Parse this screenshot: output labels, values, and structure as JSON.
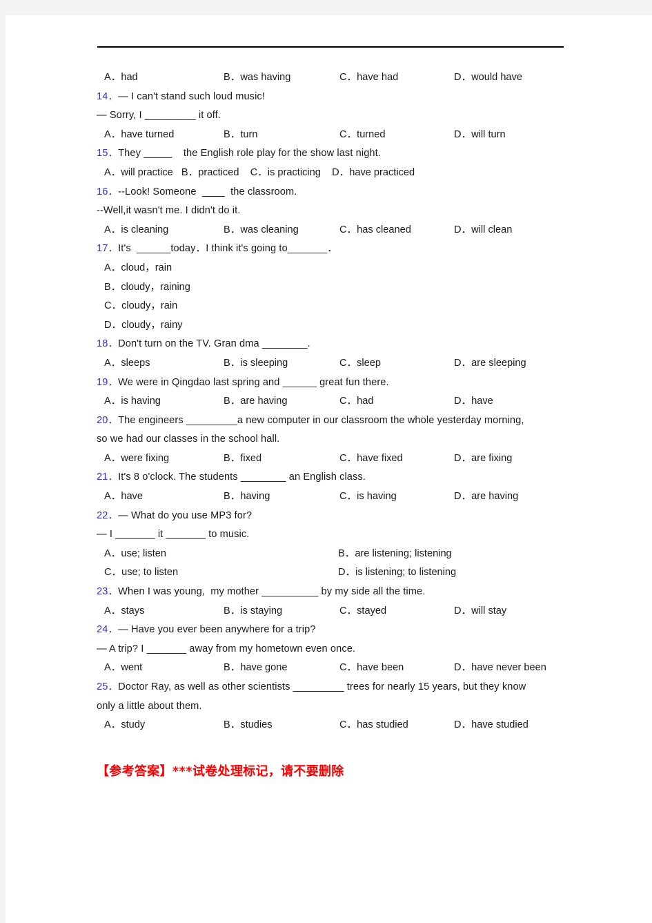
{
  "document": {
    "type": "english-grammar-worksheet",
    "colors": {
      "page_background": "#ffffff",
      "outer_background": "#f3f3f3",
      "question_number": "#3333cc",
      "body_text": "#1a1a1a",
      "answer_key": "#ff0000",
      "rule": "#000000"
    },
    "q13_options": {
      "a": "A．had",
      "b": "B．was having",
      "c": "C．have had",
      "d": "D．would have"
    },
    "q14": {
      "number": "14．",
      "stem_line1": "— I can't stand such loud music!",
      "stem_line2": "— Sorry, I _________ it off.",
      "options": {
        "a": "A．have turned",
        "b": "B．turn",
        "c": "C．turned",
        "d": "D．will turn"
      }
    },
    "q15": {
      "number": "15．",
      "stem": "They _____    the English role play for the show last night.",
      "options_inline": "A．will practice   B．practiced    C．is practicing    D．have practiced"
    },
    "q16": {
      "number": "16．",
      "stem_line1": "--Look! Someone  ____  the classroom.",
      "stem_line2": "--Well,it wasn't me. I didn't do it.",
      "options": {
        "a": "A．is cleaning",
        "b": "B．was cleaning",
        "c": "C．has cleaned",
        "d": "D．will clean"
      }
    },
    "q17": {
      "number": "17．",
      "stem": "It's  ______today．I think it's going to_______．",
      "options_stacked": [
        "A．cloud，rain",
        "B．cloudy，raining",
        "C．cloudy，rain",
        "D．cloudy，rainy"
      ]
    },
    "q18": {
      "number": "18．",
      "stem": "Don't turn on the TV. Gran dma ________.",
      "options": {
        "a": "A．sleeps",
        "b": "B．is sleeping",
        "c": "C．sleep",
        "d": "D．are sleeping"
      }
    },
    "q19": {
      "number": "19．",
      "stem": "We were in Qingdao last spring and ______ great fun there.",
      "options": {
        "a": "A．is having",
        "b": "B．are having",
        "c": "C．had",
        "d": "D．have"
      }
    },
    "q20": {
      "number": "20．",
      "stem_line1": "The engineers _________a new computer in our classroom the whole yesterday morning,",
      "stem_line2": "so we had our classes in the school hall.",
      "options": {
        "a": "A．were fixing",
        "b": "B．fixed",
        "c": "C．have fixed",
        "d": "D．are fixing"
      }
    },
    "q21": {
      "number": "21．",
      "stem": "It's 8 o'clock. The students ________ an English class.",
      "options": {
        "a": "A．have",
        "b": "B．having",
        "c": "C．is having",
        "d": "D．are having"
      }
    },
    "q22": {
      "number": "22．",
      "stem_line1": "— What do you use MP3 for?",
      "stem_line2": "— I _______ it _______ to music.",
      "options": {
        "a": "A．use; listen",
        "b": "B．are listening; listening",
        "c": "C．use; to listen",
        "d": "D．is listening; to listening"
      }
    },
    "q23": {
      "number": "23．",
      "stem": "When I was young,  my mother __________ by my side all the time.",
      "options": {
        "a": "A．stays",
        "b": "B．is staying",
        "c": "C．stayed",
        "d": "D．will stay"
      }
    },
    "q24": {
      "number": "24．",
      "stem_line1": "— Have you ever been anywhere for a trip?",
      "stem_line2": "— A trip? I _______ away from my hometown even once.",
      "options": {
        "a": "A．went",
        "b": "B．have gone",
        "c": "C．have been",
        "d": "D．have never been"
      }
    },
    "q25": {
      "number": "25．",
      "stem_line1": "Doctor Ray, as well as other scientists _________ trees for nearly 15 years, but they know",
      "stem_line2": "only a little about them.",
      "options": {
        "a": "A．study",
        "b": "B．studies",
        "c": "C．has studied",
        "d": "D．have studied"
      }
    },
    "answer_key_marker": "【参考答案】***试卷处理标记，请不要删除"
  }
}
